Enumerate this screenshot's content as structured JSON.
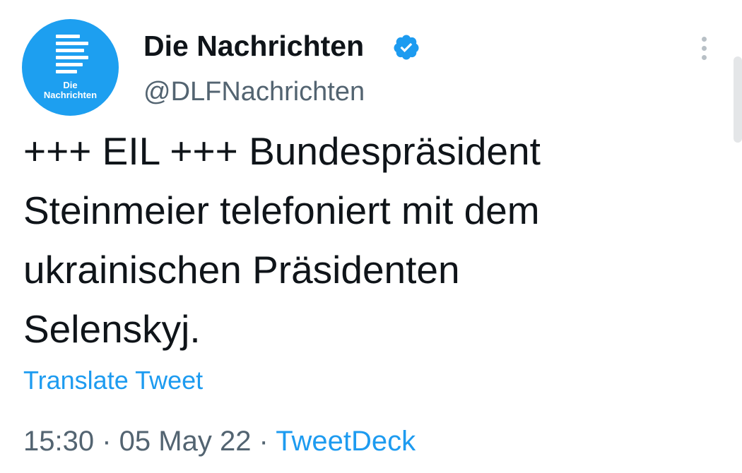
{
  "account": {
    "display_name": "Die Nachrichten",
    "handle": "@DLFNachrichten",
    "avatar_text_line1": "Die",
    "avatar_text_line2": "Nachrichten",
    "verified": true
  },
  "tweet": {
    "text_lines": [
      "+++ EIL +++ Bundespräsident",
      "Steinmeier telefoniert mit dem",
      "ukrainischen Präsidenten",
      "Selenskyj."
    ],
    "translate_label": "Translate Tweet",
    "time": "15:30",
    "date": "05 May 22",
    "separator": " · ",
    "source": "TweetDeck"
  },
  "icons": {
    "verified": "verified-badge-icon",
    "more": "more-options-icon",
    "avatar": "die-nachrichten-logo"
  },
  "colors": {
    "avatar_bg": "#1d9ff0",
    "link": "#1d9bf0",
    "text": "#0f1419",
    "secondary": "#536471"
  }
}
